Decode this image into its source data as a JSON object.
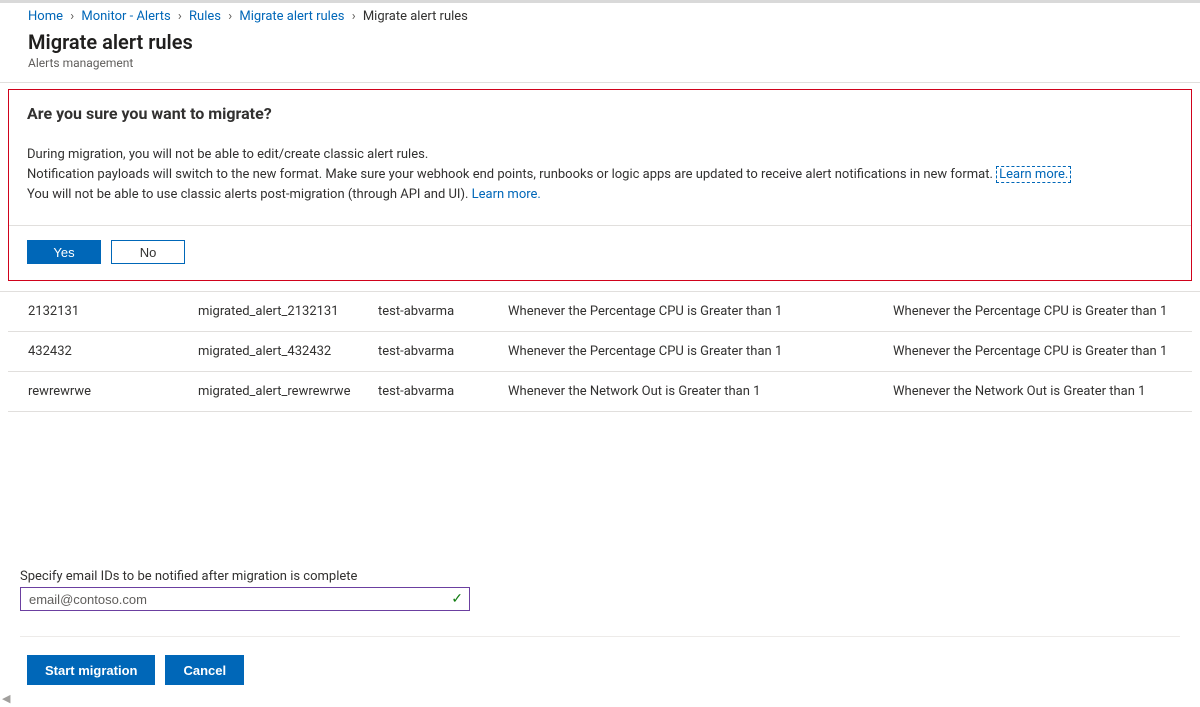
{
  "breadcrumb": {
    "items": [
      {
        "label": "Home",
        "link": true
      },
      {
        "label": "Monitor - Alerts",
        "link": true
      },
      {
        "label": "Rules",
        "link": true
      },
      {
        "label": "Migrate alert rules",
        "link": true
      },
      {
        "label": "Migrate alert rules",
        "link": false
      }
    ]
  },
  "header": {
    "title": "Migrate alert rules",
    "subtitle": "Alerts management"
  },
  "dialog": {
    "title": "Are you sure you want to migrate?",
    "line1": "During migration, you will not be able to edit/create classic alert rules.",
    "line2_prefix": "Notification payloads will switch to the new format. Make sure your webhook end points, runbooks or logic apps are updated to receive alert notifications in new format. ",
    "line2_link": "Learn more.",
    "line3_prefix": "You will not be able to use classic alerts post-migration (through API and UI). ",
    "line3_link": "Learn more.",
    "yes": "Yes",
    "no": "No"
  },
  "table": {
    "rows": [
      {
        "classic": "2132131",
        "migrated": "migrated_alert_2132131",
        "rg": "test-abvarma",
        "cond": "Whenever the Percentage CPU is Greater than 1",
        "cond2": "Whenever the Percentage CPU is Greater than 1"
      },
      {
        "classic": "432432",
        "migrated": "migrated_alert_432432",
        "rg": "test-abvarma",
        "cond": "Whenever the Percentage CPU is Greater than 1",
        "cond2": "Whenever the Percentage CPU is Greater than 1"
      },
      {
        "classic": "rewrewrwe",
        "migrated": "migrated_alert_rewrewrwe",
        "rg": "test-abvarma",
        "cond": "Whenever the Network Out is Greater than 1",
        "cond2": "Whenever the Network Out is Greater than 1"
      }
    ]
  },
  "email": {
    "label": "Specify email IDs to be notified after migration is complete",
    "value": "email@contoso.com"
  },
  "footer": {
    "start": "Start migration",
    "cancel": "Cancel"
  }
}
